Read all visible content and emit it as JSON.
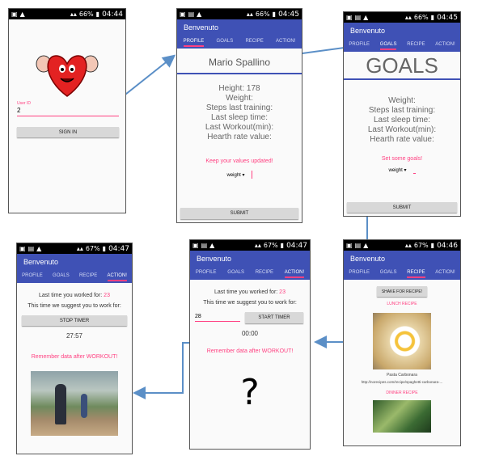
{
  "status": {
    "s1": {
      "time": "04:44",
      "battery": "66%"
    },
    "s2": {
      "time": "04:45",
      "battery": "66%"
    },
    "s3": {
      "time": "04:45",
      "battery": "66%"
    },
    "s4": {
      "time": "04:46",
      "battery": "67%"
    },
    "s5": {
      "time": "04:47",
      "battery": "67%"
    },
    "s6": {
      "time": "04:47",
      "battery": "67%"
    }
  },
  "app_title": "Benvenuto",
  "tabs": [
    "PROFILE",
    "GOALS",
    "RECIPE",
    "ACTION!"
  ],
  "login": {
    "label": "User ID",
    "value": "2",
    "button": "SIGN IN"
  },
  "profile": {
    "name": "Mario  Spallino",
    "height": "Height: 178",
    "weight": "Weight:",
    "steps": "Steps last training:",
    "sleep": "Last sleep time:",
    "workout": "Last Workout(min):",
    "heart": "Hearth rate value:",
    "reminder": "Keep your values updated!",
    "select": "weight",
    "submit": "SUBMIT"
  },
  "goals": {
    "header": "GOALS",
    "weight": "Weight:",
    "steps": "Steps last training:",
    "sleep": "Last sleep time:",
    "workout": "Last Workout(min):",
    "heart": "Hearth rate value:",
    "prompt": "Set some goals!",
    "select": "weight",
    "submit": "SUBMIT"
  },
  "recipe": {
    "shake": "SHAKE FOR RECIPE!",
    "lunch": "LUNCH RECIPE",
    "dish": "Pasta Carbonara",
    "url": "http://norecipes.com/recipe/spaghetti-carbonara-...",
    "dinner": "DINNER RECIPE"
  },
  "action1": {
    "last_label": "Last time you worked for:",
    "last_value": "23",
    "suggest": "This time we suggest you to work for:",
    "input": "28",
    "start": "START TIMER",
    "timer": "00:00",
    "remember": "Remember data after WORKOUT!",
    "question": "?"
  },
  "action2": {
    "last_label": "Last time you worked for:",
    "last_value": "23",
    "suggest": "This time we suggest you to work for:",
    "stop": "STOP TIMER",
    "timer": "27:57",
    "remember": "Remember data after WORKOUT!"
  }
}
